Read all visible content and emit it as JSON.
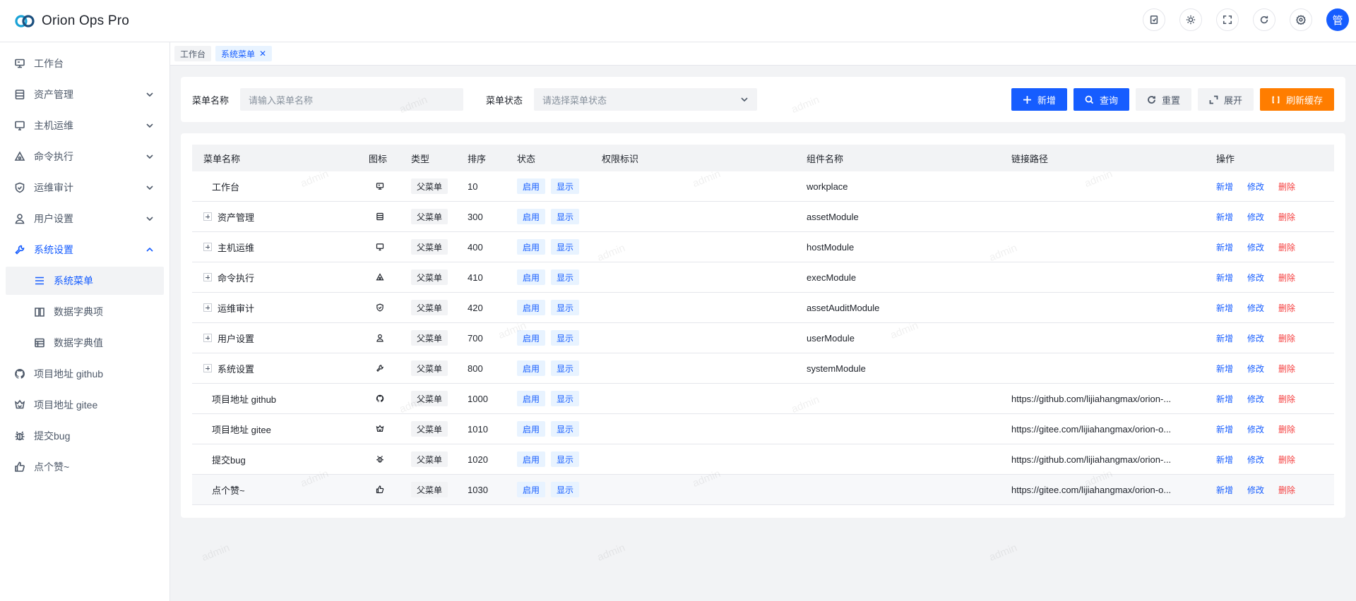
{
  "app": {
    "title": "Orion Ops Pro",
    "user_avatar": "管"
  },
  "header": {
    "icons": [
      "doc-icon",
      "theme-icon",
      "fullscreen-icon",
      "refresh-icon",
      "settings-icon"
    ]
  },
  "sidebar": {
    "items": [
      {
        "label": "工作台",
        "icon": "dashboard-icon"
      },
      {
        "label": "资产管理",
        "icon": "asset-icon"
      },
      {
        "label": "主机运维",
        "icon": "monitor-icon"
      },
      {
        "label": "命令执行",
        "icon": "command-icon"
      },
      {
        "label": "运维审计",
        "icon": "shield-icon"
      },
      {
        "label": "用户设置",
        "icon": "user-icon"
      },
      {
        "label": "系统设置",
        "icon": "wrench-icon"
      },
      {
        "label": "系统菜单",
        "icon": "menu-icon"
      },
      {
        "label": "数据字典项",
        "icon": "book-icon"
      },
      {
        "label": "数据字典值",
        "icon": "table-icon"
      },
      {
        "label": "项目地址 github",
        "icon": "github-icon"
      },
      {
        "label": "项目地址 gitee",
        "icon": "gitee-icon"
      },
      {
        "label": "提交bug",
        "icon": "bug-icon"
      },
      {
        "label": "点个赞~",
        "icon": "thumb-up-icon"
      }
    ]
  },
  "tabs": [
    {
      "label": "工作台"
    },
    {
      "label": "系统菜单"
    }
  ],
  "search": {
    "name_label": "菜单名称",
    "name_placeholder": "请输入菜单名称",
    "status_label": "菜单状态",
    "status_placeholder": "请选择菜单状态",
    "buttons": {
      "add": "新增",
      "query": "查询",
      "reset": "重置",
      "expand": "展开",
      "refresh_cache": "刷新缓存"
    }
  },
  "table": {
    "columns": [
      "菜单名称",
      "图标",
      "类型",
      "排序",
      "状态",
      "权限标识",
      "组件名称",
      "链接路径",
      "操作"
    ],
    "rows": [
      {
        "name": "工作台",
        "type": "父菜单",
        "sort": "10",
        "status": "启用",
        "visible": "显示",
        "perm": "",
        "component": "workplace",
        "path": ""
      },
      {
        "name": "资产管理",
        "type": "父菜单",
        "sort": "300",
        "status": "启用",
        "visible": "显示",
        "perm": "",
        "component": "assetModule",
        "path": ""
      },
      {
        "name": "主机运维",
        "type": "父菜单",
        "sort": "400",
        "status": "启用",
        "visible": "显示",
        "perm": "",
        "component": "hostModule",
        "path": ""
      },
      {
        "name": "命令执行",
        "type": "父菜单",
        "sort": "410",
        "status": "启用",
        "visible": "显示",
        "perm": "",
        "component": "execModule",
        "path": ""
      },
      {
        "name": "运维审计",
        "type": "父菜单",
        "sort": "420",
        "status": "启用",
        "visible": "显示",
        "perm": "",
        "component": "assetAuditModule",
        "path": ""
      },
      {
        "name": "用户设置",
        "type": "父菜单",
        "sort": "700",
        "status": "启用",
        "visible": "显示",
        "perm": "",
        "component": "userModule",
        "path": ""
      },
      {
        "name": "系统设置",
        "type": "父菜单",
        "sort": "800",
        "status": "启用",
        "visible": "显示",
        "perm": "",
        "component": "systemModule",
        "path": ""
      },
      {
        "name": "项目地址 github",
        "type": "父菜单",
        "sort": "1000",
        "status": "启用",
        "visible": "显示",
        "perm": "",
        "component": "",
        "path": "https://github.com/lijiahangmax/orion-..."
      },
      {
        "name": "项目地址 gitee",
        "type": "父菜单",
        "sort": "1010",
        "status": "启用",
        "visible": "显示",
        "perm": "",
        "component": "",
        "path": "https://gitee.com/lijiahangmax/orion-o..."
      },
      {
        "name": "提交bug",
        "type": "父菜单",
        "sort": "1020",
        "status": "启用",
        "visible": "显示",
        "perm": "",
        "component": "",
        "path": "https://github.com/lijiahangmax/orion-..."
      },
      {
        "name": "点个赞~",
        "type": "父菜单",
        "sort": "1030",
        "status": "启用",
        "visible": "显示",
        "perm": "",
        "component": "",
        "path": "https://gitee.com/lijiahangmax/orion-o..."
      }
    ],
    "ops": {
      "add": "新增",
      "edit": "修改",
      "delete": "删除"
    }
  },
  "watermark": "admin",
  "colors": {
    "primary": "#165dff",
    "warning": "#ff7d00",
    "danger": "#f53f3f"
  }
}
